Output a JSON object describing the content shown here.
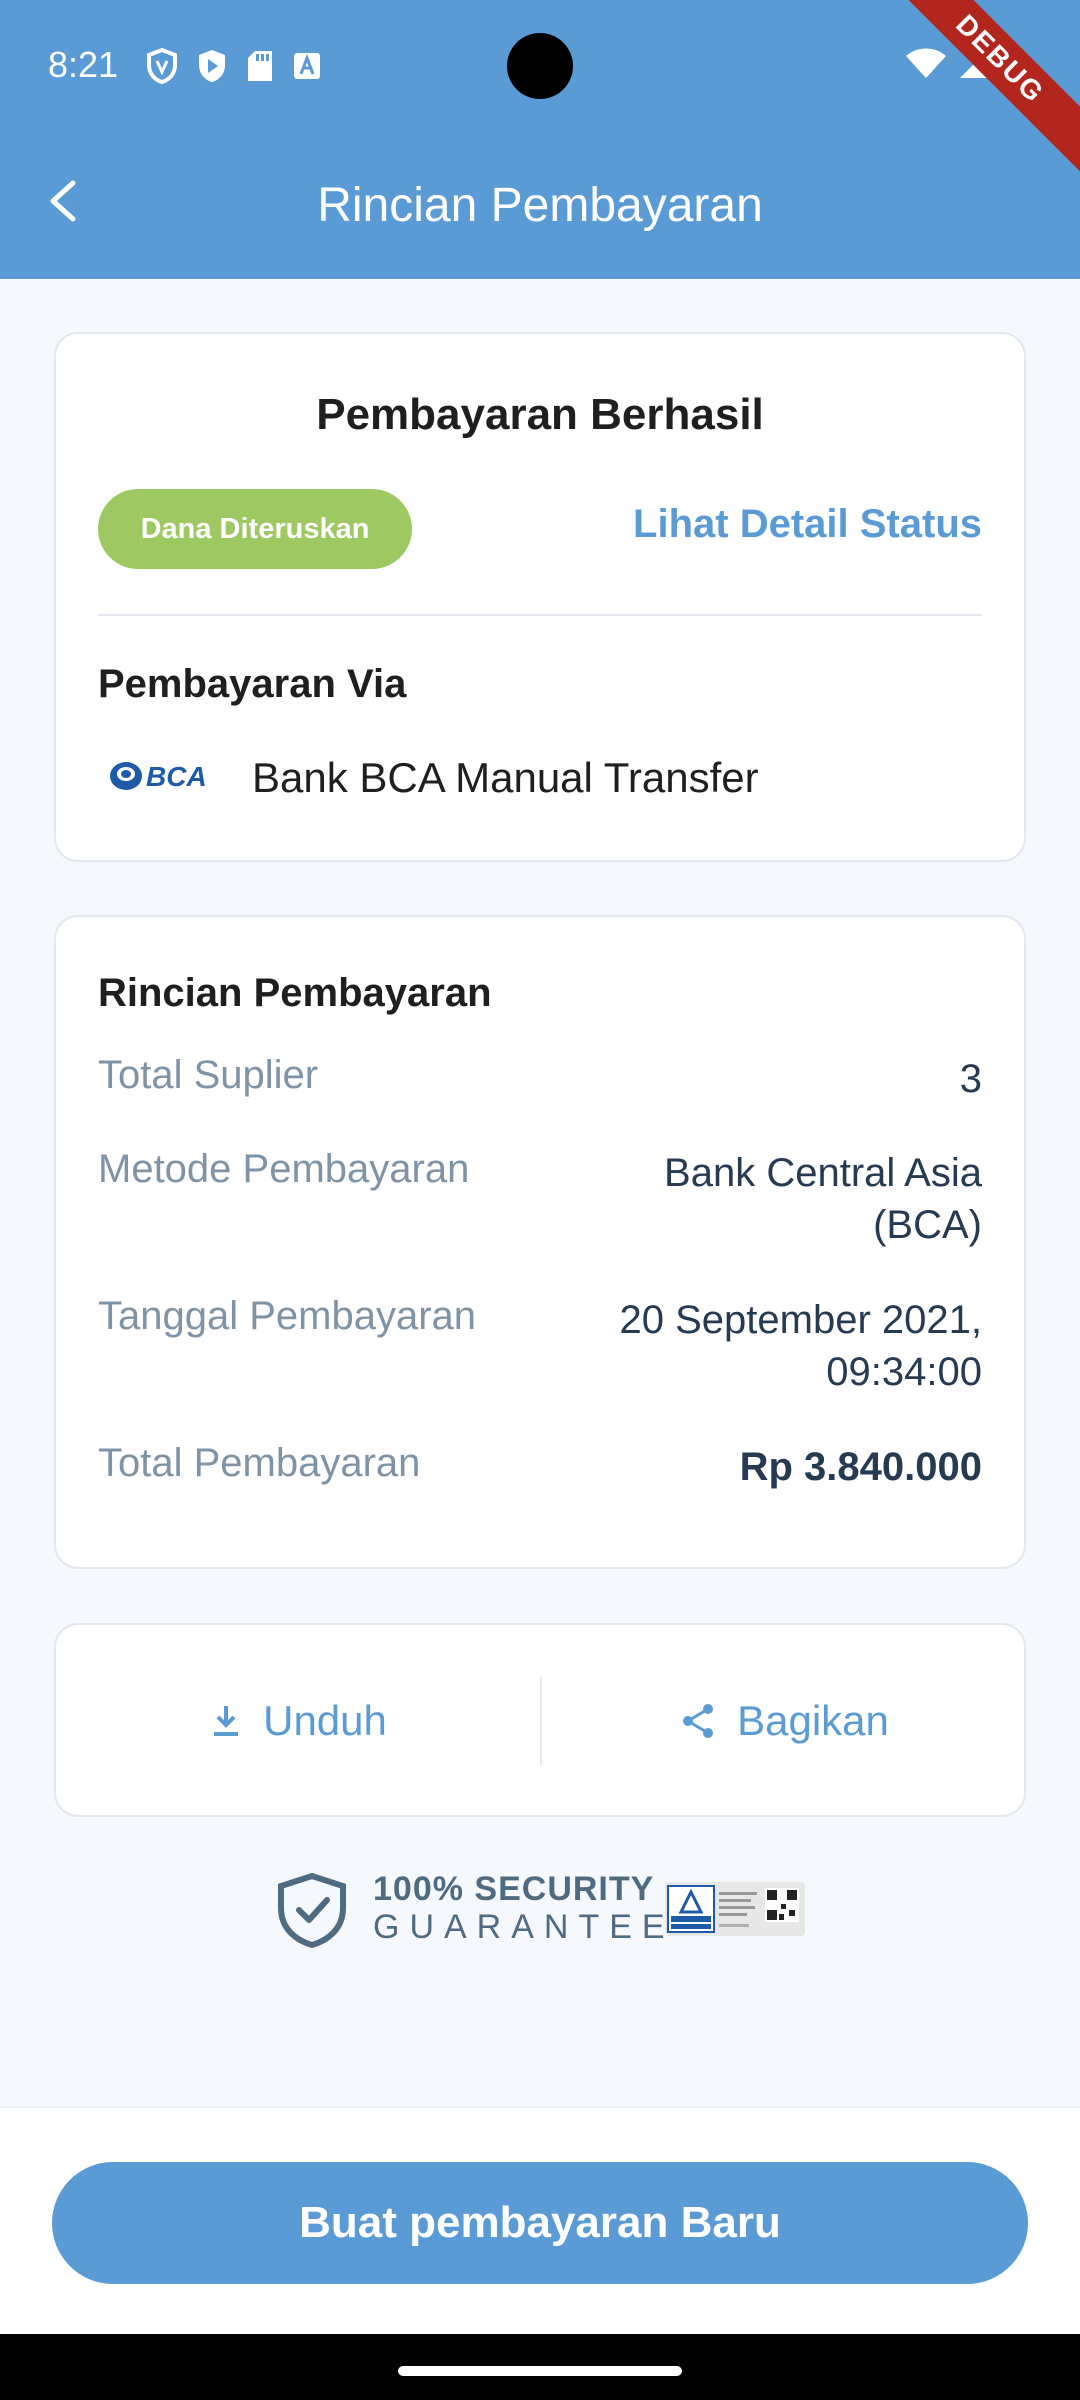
{
  "status_bar": {
    "time": "8:21",
    "left_icons": [
      "vpn-shield-icon",
      "play-shield-icon",
      "sd-card-icon",
      "keyboard-a-icon"
    ],
    "right_icons": [
      "wifi-icon",
      "signal-icon",
      "battery-icon"
    ],
    "debug_label": "DEBUG"
  },
  "app_bar": {
    "title": "Rincian Pembayaran",
    "back_icon": "chevron-left-icon"
  },
  "status_card": {
    "title": "Pembayaran Berhasil",
    "badge": "Dana Diteruskan",
    "badge_color": "#9dc862",
    "link": "Lihat Detail Status",
    "via_label": "Pembayaran Via",
    "bank_logo_text": "BCA",
    "bank_name": "Bank BCA Manual Transfer"
  },
  "detail_card": {
    "title": "Rincian Pembayaran",
    "rows": [
      {
        "label": "Total Suplier",
        "value": "3"
      },
      {
        "label": "Metode Pembayaran",
        "value": "Bank Central Asia (BCA)"
      },
      {
        "label": "Tanggal Pembayaran",
        "value": "20 September 2021, 09:34:00"
      },
      {
        "label": "Total Pembayaran",
        "value": "Rp 3.840.000"
      }
    ]
  },
  "actions": {
    "download": {
      "label": "Unduh",
      "icon": "download-icon"
    },
    "share": {
      "label": "Bagikan",
      "icon": "share-icon"
    }
  },
  "security": {
    "line1": "100% SECURITY",
    "line2": "GUARANTEE",
    "icon": "shield-check-icon"
  },
  "bottom": {
    "primary_button": "Buat pembayaran Baru"
  },
  "colors": {
    "primary": "#5b9bd5",
    "success": "#9dc862",
    "muted_text": "#7f93a6",
    "value_text": "#263a52"
  }
}
